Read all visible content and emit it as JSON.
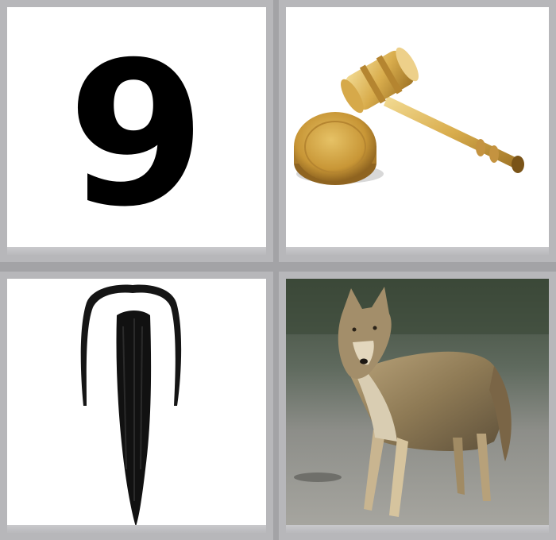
{
  "tiles": [
    {
      "kind": "number",
      "text": "9"
    },
    {
      "kind": "image",
      "icon": "gavel-icon"
    },
    {
      "kind": "image",
      "icon": "mustache-beard-icon"
    },
    {
      "kind": "image",
      "icon": "wolf-icon"
    }
  ],
  "colors": {
    "frame": "#b7b7ba",
    "background": "#a3a3a6",
    "tile": "#ffffff"
  }
}
